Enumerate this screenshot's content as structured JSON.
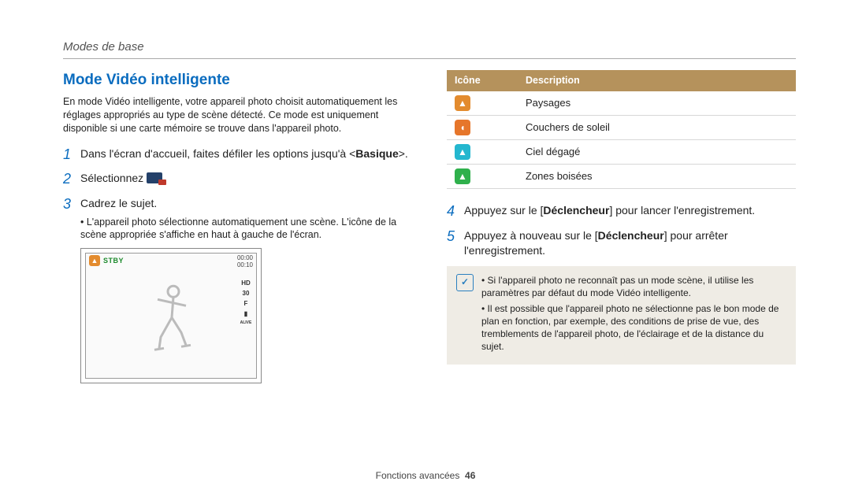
{
  "breadcrumb": "Modes de base",
  "title": "Mode Vidéo intelligente",
  "intro": "En mode Vidéo intelligente, votre appareil photo choisit automatiquement les réglages appropriés au type de scène détecté. Ce mode est uniquement disponible si une carte mémoire se trouve dans l'appareil photo.",
  "steps": {
    "s1": {
      "num": "1",
      "pre": "Dans l'écran d'accueil, faites défiler les options jusqu'à <",
      "bold": "Basique",
      "post": ">."
    },
    "s2": {
      "num": "2",
      "pre": "Sélectionnez ",
      "post": "."
    },
    "s3": {
      "num": "3",
      "text": "Cadrez le sujet.",
      "bullet": "L'appareil photo sélectionne automatiquement une scène. L'icône de la scène appropriée s'affiche en haut à gauche de l'écran."
    },
    "s4": {
      "num": "4",
      "pre": "Appuyez sur le [",
      "bold": "Déclencheur",
      "post": "] pour lancer l'enregistrement."
    },
    "s5": {
      "num": "5",
      "pre": "Appuyez à nouveau sur le [",
      "bold": "Déclencheur",
      "post": "] pour arrêter l'enregistrement."
    }
  },
  "screen": {
    "stby": "STBY",
    "time": "00:00",
    "clock": "00:10",
    "side": {
      "hd": "HD",
      "fps": "30",
      "f": "F",
      "mic": "▮",
      "alive": "ALIVE"
    }
  },
  "table": {
    "head": {
      "icon": "Icône",
      "desc": "Description"
    },
    "rows": [
      {
        "icon_name": "landscape-icon",
        "glyph": "▲",
        "cls": "ic-orange",
        "desc": "Paysages"
      },
      {
        "icon_name": "sunset-icon",
        "glyph": "◖",
        "cls": "ic-sunset",
        "desc": "Couchers de soleil"
      },
      {
        "icon_name": "clear-sky-icon",
        "glyph": "▲",
        "cls": "ic-cyan",
        "desc": "Ciel dégagé"
      },
      {
        "icon_name": "wooded-icon",
        "glyph": "▲",
        "cls": "ic-green",
        "desc": "Zones boisées"
      }
    ]
  },
  "note": {
    "badge": "✓",
    "items": [
      "Si l'appareil photo ne reconnaît pas un mode scène, il utilise les paramètres par défaut du mode Vidéo intelligente.",
      "Il est possible que l'appareil photo ne sélectionne pas le bon mode de plan en fonction, par exemple, des conditions de prise de vue, des tremblements de l'appareil photo, de l'éclairage et de la distance du sujet."
    ]
  },
  "footer": {
    "label": "Fonctions avancées",
    "page": "46"
  }
}
